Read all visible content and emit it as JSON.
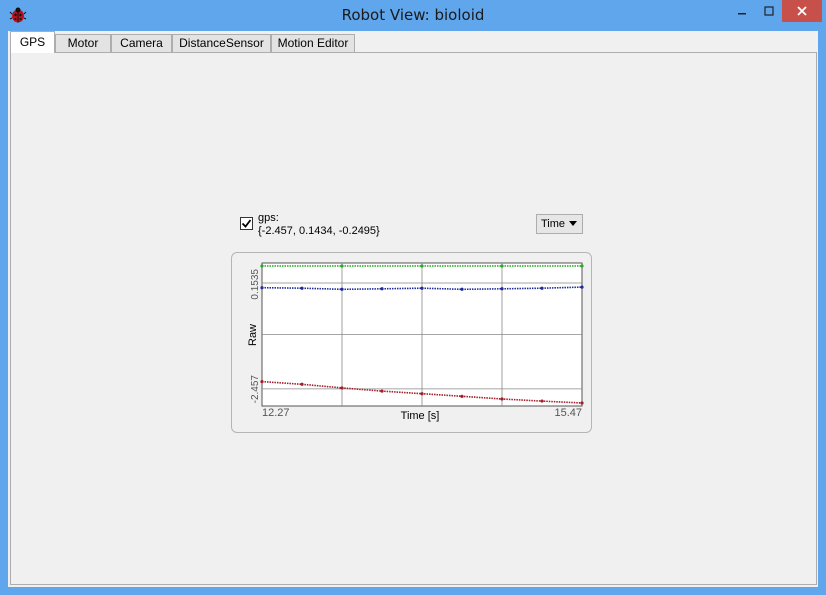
{
  "window": {
    "title": "Robot View: bioloid"
  },
  "tabs": [
    {
      "label": "GPS",
      "active": true
    },
    {
      "label": "Motor",
      "active": false
    },
    {
      "label": "Camera",
      "active": false
    },
    {
      "label": "DistanceSensor",
      "active": false
    },
    {
      "label": "Motion Editor",
      "active": false
    }
  ],
  "gps": {
    "checked": true,
    "label": "gps:",
    "value": "{-2.457, 0.1434, -0.2495}"
  },
  "dropdown": {
    "selected": "Time"
  },
  "colors": {
    "series_green": "#22aa22",
    "series_blue": "#1f2a9c",
    "series_red": "#a31e2a"
  },
  "chart_data": {
    "type": "line",
    "xlabel": "Time [s]",
    "ylabel": "Raw",
    "x_tick_labels": [
      "12.27",
      "15.47"
    ],
    "y_tick_labels": [
      "0.1535",
      "-2.457"
    ],
    "xlim": [
      12.27,
      15.47
    ],
    "ylim": [
      -2.457,
      0.1535
    ],
    "grid": true,
    "series": [
      {
        "color": "#22aa22",
        "x": [
          12.27,
          13.07,
          13.87,
          14.67,
          15.47
        ],
        "y": [
          0.1535,
          0.1535,
          0.1535,
          0.1535,
          0.1535
        ]
      },
      {
        "color": "#1f2a9c",
        "x": [
          12.27,
          12.67,
          13.07,
          13.47,
          13.87,
          14.27,
          14.67,
          15.07,
          15.47
        ],
        "y": [
          -0.26,
          -0.27,
          -0.29,
          -0.28,
          -0.27,
          -0.29,
          -0.28,
          -0.27,
          -0.2495
        ]
      },
      {
        "color": "#a31e2a",
        "x": [
          12.27,
          12.67,
          13.07,
          13.47,
          13.87,
          14.27,
          14.67,
          15.07,
          15.47
        ],
        "y": [
          -2.05,
          -2.1,
          -2.17,
          -2.23,
          -2.28,
          -2.33,
          -2.38,
          -2.42,
          -2.457
        ]
      }
    ]
  }
}
